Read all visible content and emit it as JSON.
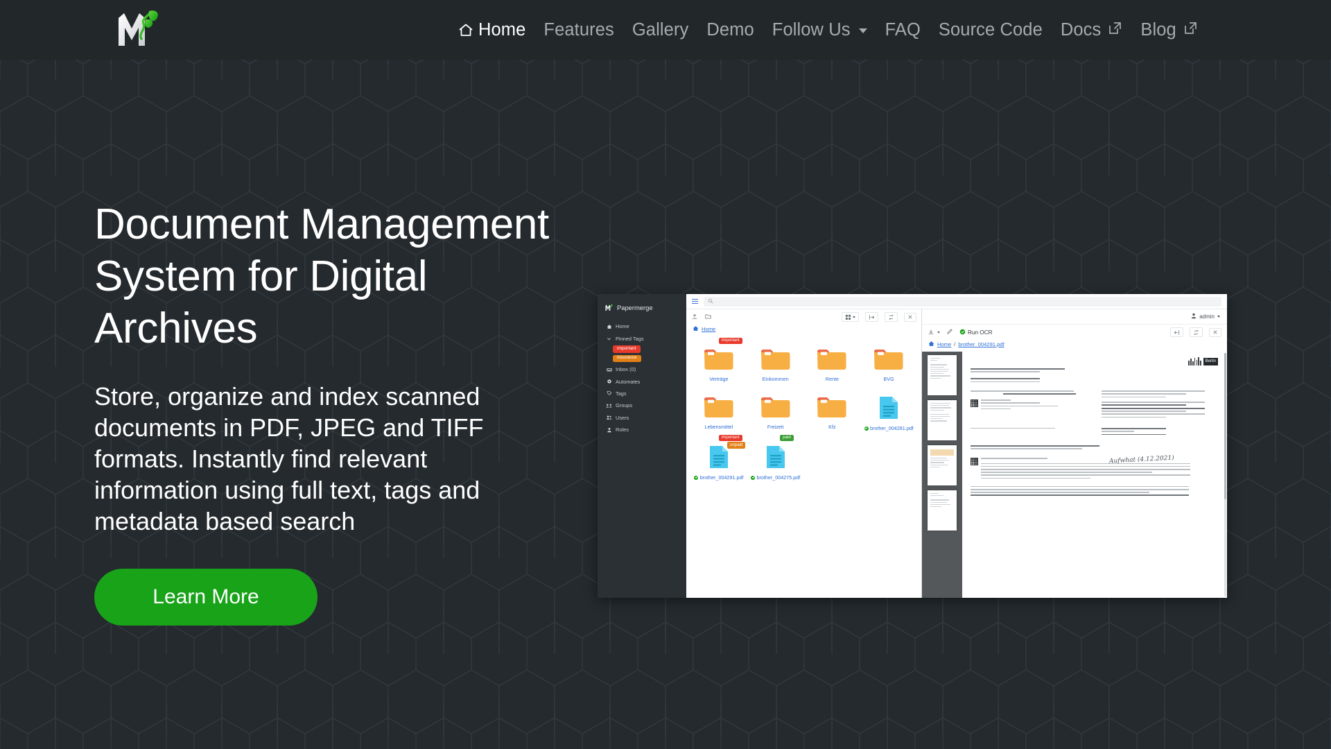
{
  "site": {
    "brand_name": "Papermerge",
    "bg_color": "#242a2e",
    "navbar_color": "#22272a",
    "accent_green": "#19a319"
  },
  "nav": {
    "items": [
      {
        "label": "Home",
        "icon": "home-icon",
        "active": true
      },
      {
        "label": "Features",
        "active": false
      },
      {
        "label": "Gallery",
        "active": false
      },
      {
        "label": "Demo",
        "active": false
      },
      {
        "label": "Follow Us",
        "icon": "chevron-down-icon",
        "dropdown": true,
        "active": false
      },
      {
        "label": "FAQ",
        "active": false
      },
      {
        "label": "Source Code",
        "active": false
      },
      {
        "label": "Docs",
        "icon": "external-link-icon",
        "external": true,
        "active": false
      },
      {
        "label": "Blog",
        "icon": "external-link-icon",
        "external": true,
        "active": false
      }
    ]
  },
  "hero": {
    "title": "Document Management System for Digital Archives",
    "subtitle": "Store, organize and index scanned documents in PDF, JPEG and TIFF formats. Instantly find relevant information using full text, tags and metadata based search",
    "cta_label": "Learn More"
  },
  "app_screenshot": {
    "sidebar": {
      "brand": "Papermerge",
      "items": [
        {
          "label": "Home",
          "icon": "home-icon"
        },
        {
          "label": "Pinned Tags",
          "icon": "chevron-down-icon"
        },
        {
          "label": "Inbox (0)",
          "icon": "inbox-icon"
        },
        {
          "label": "Automates",
          "icon": "automates-icon"
        },
        {
          "label": "Tags",
          "icon": "tag-icon"
        },
        {
          "label": "Groups",
          "icon": "groups-icon"
        },
        {
          "label": "Users",
          "icon": "users-icon"
        },
        {
          "label": "Roles",
          "icon": "roles-icon"
        }
      ],
      "pinned_tags": [
        {
          "label": "important",
          "color": "#e8392b"
        },
        {
          "label": "insurance",
          "color": "#e28017"
        }
      ]
    },
    "browser": {
      "search_placeholder": "",
      "breadcrumb": [
        "Home"
      ],
      "toolbar_icons": [
        "upload-icon",
        "new-folder-icon",
        "grid-view-icon",
        "split-view-icon",
        "sort-icon",
        "close-icon"
      ],
      "items": [
        {
          "name": "Verträge",
          "type": "folder",
          "tags": [
            {
              "label": "important",
              "color": "#e8392b"
            }
          ]
        },
        {
          "name": "Einkommen",
          "type": "folder",
          "tags": []
        },
        {
          "name": "Rente",
          "type": "folder",
          "tags": []
        },
        {
          "name": "BVG",
          "type": "folder",
          "tags": []
        },
        {
          "name": "Lebensmittel",
          "type": "folder",
          "tags": []
        },
        {
          "name": "Freizeit",
          "type": "folder",
          "tags": []
        },
        {
          "name": "Kfz",
          "type": "folder",
          "tags": []
        },
        {
          "name": "brother_004281.pdf",
          "type": "document",
          "tags": []
        },
        {
          "name": "brother_004291.pdf",
          "type": "document",
          "tags": [
            {
              "label": "important",
              "color": "#e8392b"
            },
            {
              "label": "unpaid",
              "color": "#e28017"
            }
          ]
        },
        {
          "name": "brother_004275.pdf",
          "type": "document",
          "tags": [
            {
              "label": "paid",
              "color": "#3a9d35"
            }
          ]
        }
      ]
    },
    "viewer": {
      "user_label": "admin",
      "ocr_label": "Run OCR",
      "toolbar_icons": [
        "download-icon",
        "edit-icon",
        "run-ocr-icon",
        "panel-icon",
        "sort-icon",
        "close-icon"
      ],
      "breadcrumb": [
        "Home",
        "brother_004291.pdf"
      ],
      "stamp_label": "Berlin",
      "handwriting": "Aufwhat   (4.12.2021)",
      "page_count": 4
    }
  }
}
